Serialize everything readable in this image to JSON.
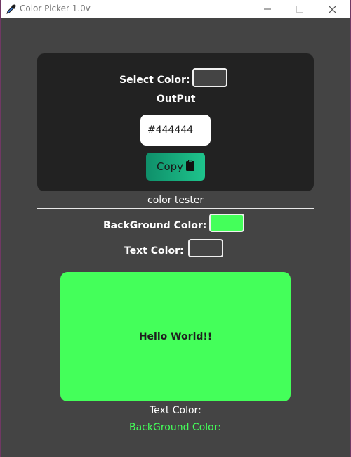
{
  "window": {
    "title": "Color Picker 1.0v",
    "icon": "eyedropper-icon"
  },
  "picker": {
    "select_label": "Select Color:",
    "selected_color": "#444444",
    "output_label": "OutPut",
    "output_value": "#444444",
    "copy_label": "Copy",
    "copy_icon": "clipboard-icon"
  },
  "tester": {
    "heading": "color tester",
    "background_label": "BackGround Color:",
    "background_color": "#44ff5a",
    "text_label": "Text Color:",
    "text_color": "#444444",
    "preview_text": "Hello World!!",
    "footer_text_label": "Text Color:",
    "footer_background_label": "BackGround Color:"
  },
  "colors": {
    "window_bg": "#444444",
    "card_bg": "#222222",
    "accent_green": "#44ff5a",
    "copy_gradient_start": "#0f8f6a",
    "copy_gradient_end": "#1ec48c"
  }
}
